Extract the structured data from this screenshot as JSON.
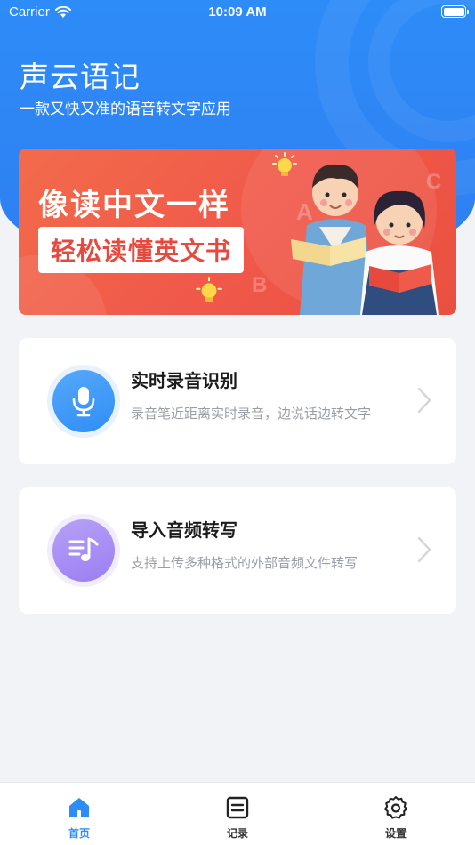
{
  "status_bar": {
    "carrier": "Carrier",
    "time": "10:09 AM"
  },
  "header": {
    "title": "声云语记",
    "subtitle": "一款又快又准的语音转文字应用"
  },
  "banner": {
    "line1": "像读中文一样",
    "line2": "轻松读懂英文书",
    "letters": [
      "A",
      "B",
      "C"
    ]
  },
  "cards": [
    {
      "title": "实时录音识别",
      "desc": "录音笔近距离实时录音，边说话边转文字",
      "icon": "microphone-icon",
      "color": "#2f8ef5"
    },
    {
      "title": "导入音频转写",
      "desc": "支持上传多种格式的外部音频文件转写",
      "icon": "music-note-icon",
      "color": "#9a7ef2"
    }
  ],
  "tabs": [
    {
      "label": "首页",
      "icon": "home-icon",
      "active": true
    },
    {
      "label": "记录",
      "icon": "record-list-icon",
      "active": false
    },
    {
      "label": "设置",
      "icon": "gear-icon",
      "active": false
    }
  ],
  "colors": {
    "primary": "#2d8cf8",
    "background": "#f2f3f7",
    "banner": "#f0584a"
  }
}
